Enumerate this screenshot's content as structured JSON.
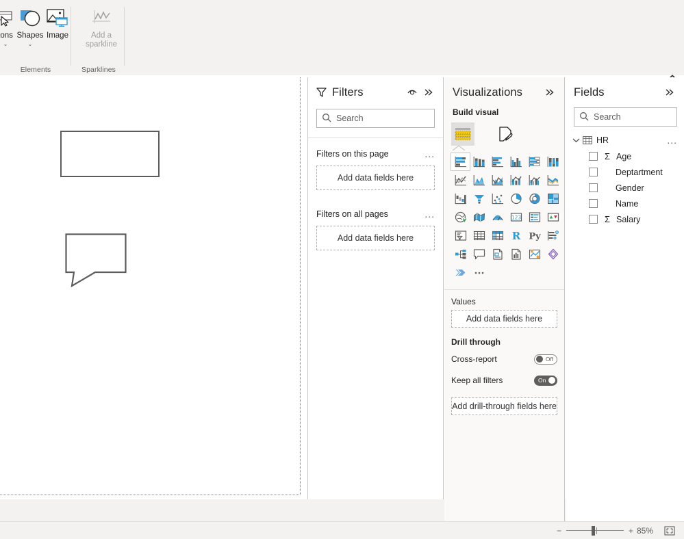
{
  "ribbon": {
    "groups": [
      {
        "label": "Elements"
      },
      {
        "label": "Sparklines"
      }
    ],
    "buttons": [
      {
        "name": "buttons",
        "label": "tons",
        "icon": "button-icon",
        "has_chevron": true,
        "disabled": false
      },
      {
        "name": "shapes",
        "label": "Shapes",
        "icon": "shapes-icon",
        "has_chevron": true,
        "disabled": false
      },
      {
        "name": "image",
        "label": "Image",
        "icon": "image-icon",
        "has_chevron": false,
        "disabled": false
      },
      {
        "name": "add-sparkline",
        "label": "Add a sparkline",
        "icon": "sparkline-icon",
        "has_chevron": false,
        "disabled": true
      }
    ],
    "collapse_icon": "chevron-up-icon"
  },
  "canvas": {
    "shapes": [
      {
        "name": "rectangle-shape",
        "type": "rectangle"
      },
      {
        "name": "callout-shape",
        "type": "speech-bubble"
      }
    ]
  },
  "filters": {
    "title": "Filters",
    "eye_icon": "eye-icon",
    "collapse_icon": "chevron-double-right-icon",
    "search": {
      "placeholder": "Search",
      "value": "",
      "icon": "search-icon"
    },
    "sections": [
      {
        "label": "Filters on this page",
        "dropzone": "Add data fields here",
        "menu": "..."
      },
      {
        "label": "Filters on all pages",
        "dropzone": "Add data fields here",
        "menu": "..."
      }
    ]
  },
  "visualizations": {
    "title": "Visualizations",
    "collapse_icon": "chevron-double-right-icon",
    "build_visual_label": "Build visual",
    "tabs": [
      {
        "name": "build-visual-tab",
        "icon": "table-grid-icon",
        "selected": true
      },
      {
        "name": "format-visual-tab",
        "icon": "paint-brush-icon",
        "selected": false
      }
    ],
    "gallery": [
      "stacked-bar-chart-icon",
      "stacked-column-chart-icon",
      "clustered-bar-chart-icon",
      "clustered-column-chart-icon",
      "100-stacked-bar-chart-icon",
      "100-stacked-column-chart-icon",
      "line-chart-icon",
      "area-chart-icon",
      "stacked-area-chart-icon",
      "line-stacked-column-chart-icon",
      "line-clustered-column-chart-icon",
      "ribbon-chart-icon",
      "waterfall-chart-icon",
      "funnel-chart-icon",
      "scatter-chart-icon",
      "pie-chart-icon",
      "donut-chart-icon",
      "treemap-icon",
      "map-icon",
      "filled-map-icon",
      "gauge-icon",
      "card-icon",
      "multi-row-card-icon",
      "kpi-icon",
      "slicer-icon",
      "table-icon",
      "matrix-icon",
      "r-script-visual-icon",
      "python-visual-icon",
      "key-influencers-icon",
      "decomposition-tree-icon",
      "qna-icon",
      "smart-narrative-icon",
      "paginated-report-icon",
      "power-apps-icon",
      "power-automate-icon",
      "arcgis-maps-icon",
      "more-options-icon"
    ],
    "selected_gallery_index": 0,
    "values": {
      "label": "Values",
      "dropzone": "Add data fields here"
    },
    "drill_through": {
      "label": "Drill through",
      "cross_report": {
        "label": "Cross-report",
        "state": "Off",
        "on": false
      },
      "keep_all_filters": {
        "label": "Keep all filters",
        "state": "On",
        "on": true
      },
      "dropzone": "Add drill-through fields here"
    }
  },
  "fields": {
    "title": "Fields",
    "collapse_icon": "chevron-double-right-icon",
    "search": {
      "placeholder": "Search",
      "value": "",
      "icon": "search-icon"
    },
    "tables": [
      {
        "name": "HR",
        "expanded": true,
        "expand_icon": "chevron-down-icon",
        "table_icon": "table-icon",
        "menu": "...",
        "fields": [
          {
            "label": "Age",
            "checked": false,
            "aggregate": "Σ"
          },
          {
            "label": "Deptartment",
            "checked": false,
            "aggregate": ""
          },
          {
            "label": "Gender",
            "checked": false,
            "aggregate": ""
          },
          {
            "label": "Name",
            "checked": false,
            "aggregate": ""
          },
          {
            "label": "Salary",
            "checked": false,
            "aggregate": "Σ"
          }
        ]
      }
    ]
  },
  "statusbar": {
    "zoom_out": "−",
    "zoom_in": "+",
    "zoom_level": "85%",
    "fit_icon": "fit-to-page-icon"
  },
  "colors": {
    "accent": "#118dff",
    "chrome": "#f3f2f1",
    "border": "#c8c6c4",
    "text": "#252423",
    "muted": "#605e5c",
    "shape_stroke": "#5c5c5c"
  }
}
